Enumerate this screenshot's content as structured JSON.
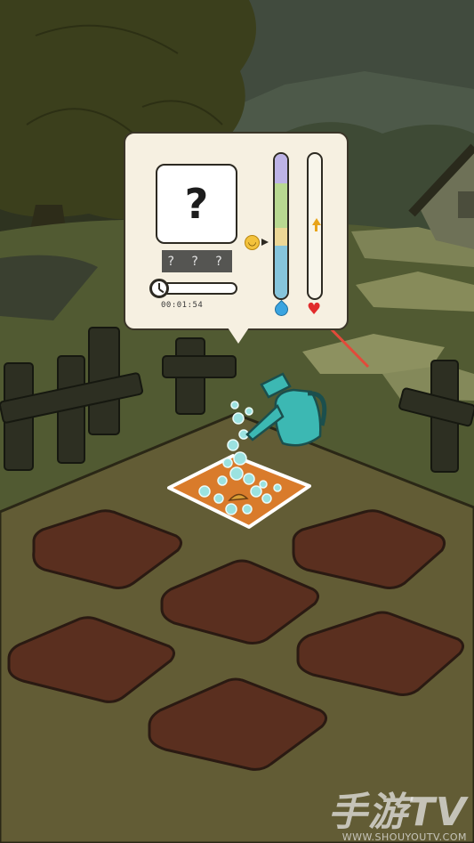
{
  "seed_panel": {
    "seed_symbol": "?",
    "seed_name": "? ? ?",
    "timer_text": "00:01:54",
    "timer_progress": 0.0,
    "water_level_indicator": "smiley",
    "colors": {
      "water_purple": "#bdb3e6",
      "water_green": "#b8d891",
      "water_yellow": "#ecd796",
      "water_blue": "#86c5dc",
      "heart": "#e12b2b",
      "drop": "#3aa4e0"
    }
  },
  "icons": {
    "timer": "clock-icon",
    "mood": "smiley-icon",
    "water": "water-drop-icon",
    "love": "heart-icon",
    "arrow": "up-arrow-icon",
    "can": "watering-can-icon"
  },
  "garden": {
    "plots": [
      "active-plot",
      "plot",
      "plot",
      "plot",
      "plot",
      "plot",
      "plot"
    ],
    "active_plot_color": "#d97b2b",
    "soil_color": "#5a2f1f"
  },
  "watermark": {
    "logo": "手游TV",
    "url": "WWW.SHOUYOUTV.COM"
  }
}
